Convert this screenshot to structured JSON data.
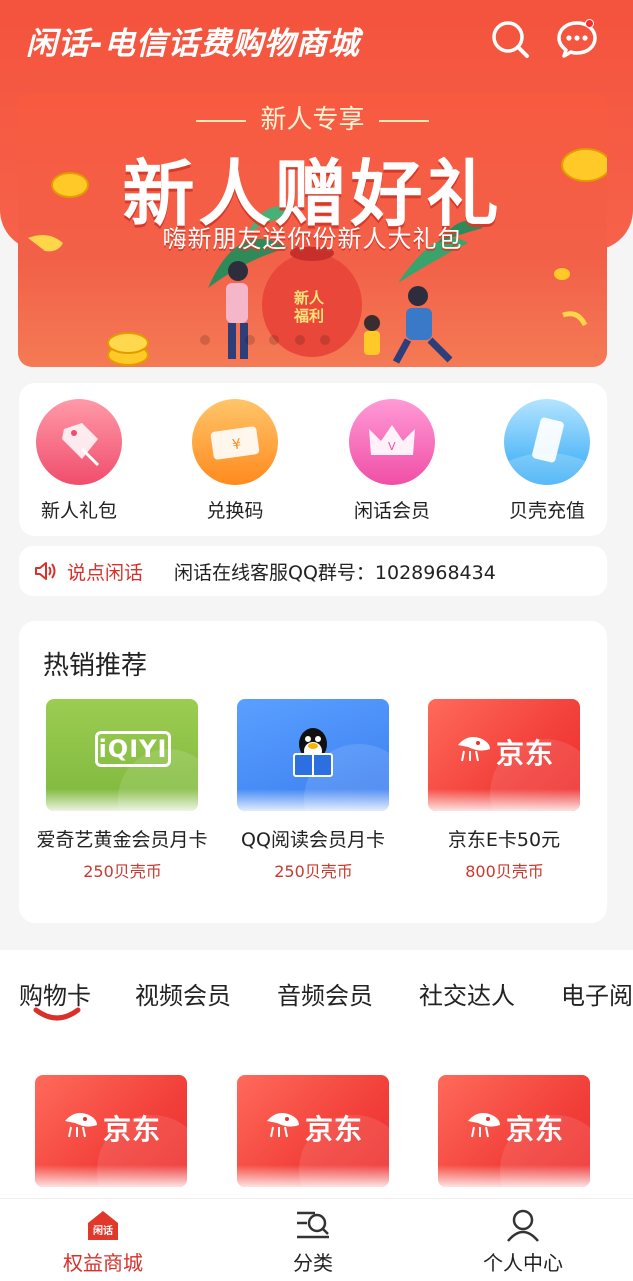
{
  "header": {
    "title": "闲话-电信话费购物商城",
    "icons": [
      "search-icon",
      "message-icon"
    ],
    "accent": "#f4533d"
  },
  "banner": {
    "subtitle": "新人专享",
    "title": "新人赠好礼",
    "desc": "嗨新朋友送你份新人大礼包",
    "bag_label_1": "新人",
    "bag_label_2": "福利"
  },
  "quick_entries": [
    {
      "label": "新人礼包",
      "icon": "gift-tag-icon"
    },
    {
      "label": "兑换码",
      "icon": "ticket-icon"
    },
    {
      "label": "闲话会员",
      "icon": "crown-icon"
    },
    {
      "label": "贝壳充值",
      "icon": "phone-card-icon"
    }
  ],
  "notice": {
    "tag": "说点闲话",
    "text": "闲话在线客服QQ群号：1028968434"
  },
  "hot": {
    "title": "热销推荐",
    "items": [
      {
        "name": "爱奇艺黄金会员月卡",
        "price": "250贝壳币",
        "logo": "iQIYI"
      },
      {
        "name": "QQ阅读会员月卡",
        "price": "250贝壳币"
      },
      {
        "name": "京东E卡50元",
        "price": "800贝壳币",
        "logo": "京东"
      }
    ]
  },
  "tabs": {
    "items": [
      "购物卡",
      "视频会员",
      "音频会员",
      "社交达人",
      "电子阅读"
    ],
    "active": "购物卡"
  },
  "products": [
    {
      "logo": "京东"
    },
    {
      "logo": "京东"
    },
    {
      "logo": "京东"
    }
  ],
  "bottom_nav": [
    {
      "label": "权益商城",
      "badge": "闲话",
      "active": true
    },
    {
      "label": "分类"
    },
    {
      "label": "个人中心"
    }
  ]
}
